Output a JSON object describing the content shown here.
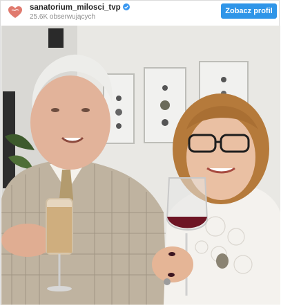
{
  "header": {
    "username": "sanatorium_milosci_tvp",
    "followers": "25.6K obserwujących",
    "view_profile_label": "Zobacz profil"
  },
  "icons": {
    "avatar": "heart-logo",
    "verified": "verified-badge-icon"
  },
  "colors": {
    "accent": "#2f95e8",
    "avatar_heart": "#e07a6e",
    "verified_badge": "#3897f0"
  },
  "photo": {
    "subject": "elderly couple toasting with drinks"
  }
}
